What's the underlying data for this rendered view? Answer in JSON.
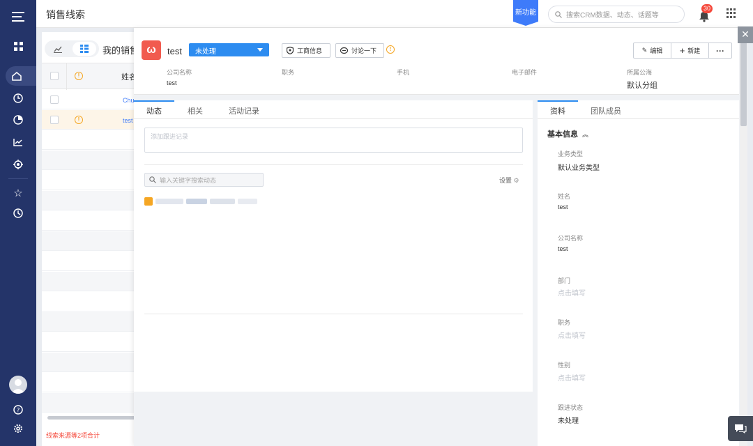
{
  "topbar": {
    "title": "销售线索",
    "new_feature": "新功能",
    "search_placeholder": "搜索CRM数据、动态、话题等",
    "notification_count": "30"
  },
  "list": {
    "title": "我的销售",
    "header_name": "姓名",
    "rows": [
      {
        "name": "Chu"
      },
      {
        "name": "test"
      }
    ],
    "footer": "线索来源等2项合计"
  },
  "record": {
    "name": "test",
    "status": "未处理",
    "btn_business": "工商信息",
    "btn_discuss": "讨论一下",
    "btn_edit": "编辑",
    "btn_new": "新建",
    "btn_more": "···",
    "fields": [
      {
        "label": "公司名称",
        "value": "test"
      },
      {
        "label": "职务",
        "value": ""
      },
      {
        "label": "手机",
        "value": ""
      },
      {
        "label": "电子邮件",
        "value": ""
      },
      {
        "label": "所属公海",
        "value": "默认分组"
      }
    ]
  },
  "activity": {
    "tabs": [
      "动态",
      "相关",
      "活动记录"
    ],
    "note_placeholder": "添加跟进记录",
    "search_placeholder": "输入关键字搜索动态",
    "settings": "设置"
  },
  "side": {
    "tabs": [
      "资料",
      "团队成员"
    ],
    "section": "基本信息",
    "fields": [
      {
        "label": "业务类型",
        "value": "默认业务类型"
      },
      {
        "label": "姓名",
        "value": "test"
      },
      {
        "label": "公司名称",
        "value": "test"
      },
      {
        "label": "部门",
        "placeholder": "点击填写"
      },
      {
        "label": "职务",
        "placeholder": "点击填写"
      },
      {
        "label": "性别",
        "placeholder": "点击填写"
      },
      {
        "label": "跟进状态",
        "value": "未处理"
      }
    ]
  },
  "colors": {
    "nav_bg": "#243469",
    "primary": "#2d8cf0",
    "accent_red": "#f5483b",
    "warning": "#f5a623"
  }
}
